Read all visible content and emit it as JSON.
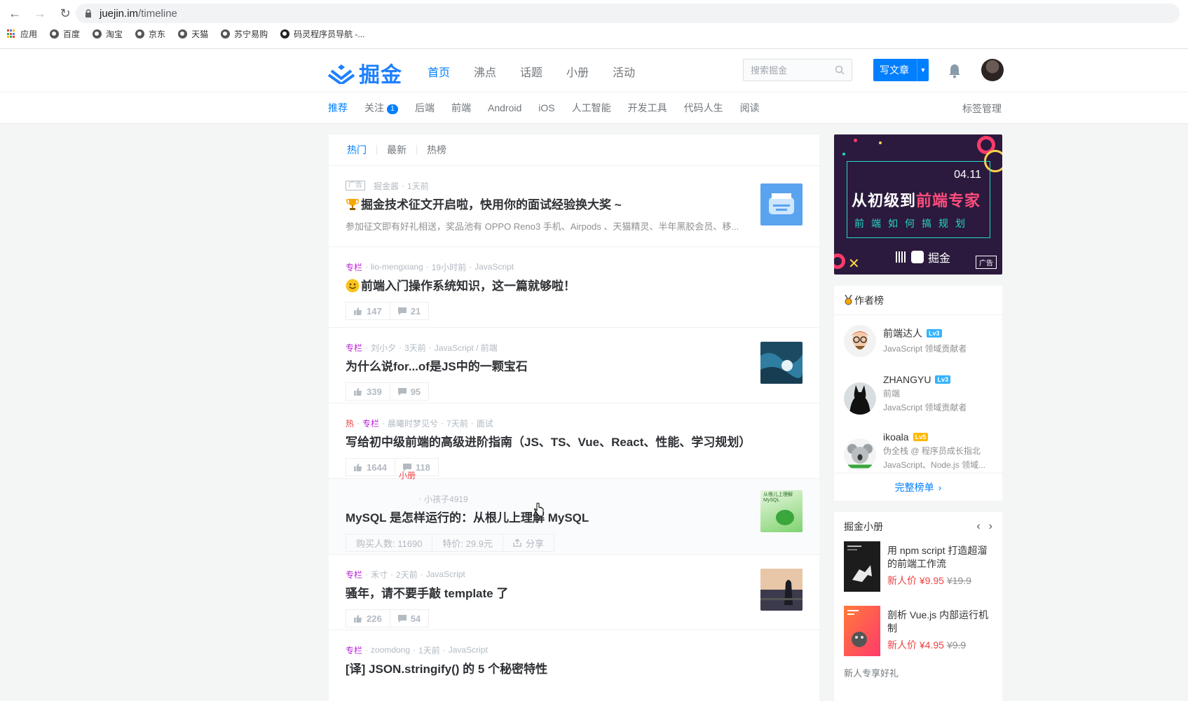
{
  "browser": {
    "url_host": "juejin.im",
    "url_path": "/timeline",
    "bookmarks": [
      {
        "label": "应用"
      },
      {
        "label": "百度"
      },
      {
        "label": "淘宝"
      },
      {
        "label": "京东"
      },
      {
        "label": "天猫"
      },
      {
        "label": "苏宁易购"
      },
      {
        "label": "码灵程序员导航 -..."
      }
    ]
  },
  "header": {
    "logo_text": "掘金",
    "nav": [
      "首页",
      "沸点",
      "话题",
      "小册",
      "活动"
    ],
    "search_placeholder": "搜索掘金",
    "write_label": "写文章"
  },
  "subnav": {
    "items": [
      "推荐",
      "关注",
      "后端",
      "前端",
      "Android",
      "iOS",
      "人工智能",
      "开发工具",
      "代码人生",
      "阅读"
    ],
    "follow_badge": "1",
    "tag_manage": "标签管理"
  },
  "feed": {
    "tabs": [
      "热门",
      "最新",
      "热榜"
    ],
    "entries": [
      {
        "ad": "广告",
        "meta": [
          "掘金酱",
          "1天前"
        ],
        "title": "掘金技术征文开启啦，快用你的面试经验换大奖 ~",
        "desc": "参加征文即有好礼相送，奖品池有 OPPO Reno3 手机、Airpods 、天猫精灵、半年黑胶会员、移..."
      },
      {
        "kind": "专栏",
        "meta": [
          "lio-mengxiang",
          "19小时前",
          "JavaScript"
        ],
        "title": "前端入门操作系统知识，这一篇就够啦！",
        "likes": "147",
        "comments": "21"
      },
      {
        "kind": "专栏",
        "meta": [
          "刘小夕",
          "3天前",
          "JavaScript / 前端"
        ],
        "title": "为什么说for...of是JS中的一颗宝石",
        "likes": "339",
        "comments": "95"
      },
      {
        "hot": "热",
        "kind": "专栏",
        "meta": [
          "晨曦时梦见兮",
          "7天前",
          "面试"
        ],
        "title": "写给初中级前端的高级进阶指南（JS、TS、Vue、React、性能、学习规划）",
        "likes": "1644",
        "comments": "118"
      },
      {
        "kind": "小册",
        "meta": [
          "小孩子4919"
        ],
        "title": "MySQL 是怎样运行的：从根儿上理解 MySQL",
        "buyers": "购买人数: 11690",
        "price": "特价: 29.9元",
        "share": "分享",
        "cover_title": "从根儿上理解MySQL"
      },
      {
        "kind": "专栏",
        "meta": [
          "禾寸",
          "2天前",
          "JavaScript"
        ],
        "title": "骚年，请不要手敲 template 了",
        "likes": "226",
        "comments": "54"
      },
      {
        "kind": "专栏",
        "meta": [
          "zoomdong",
          "1天前",
          "JavaScript"
        ],
        "title": "[译] JSON.stringify() 的 5 个秘密特性"
      }
    ]
  },
  "sidebar": {
    "banner": {
      "date": "04.11",
      "title_a": "从初级到",
      "title_b": "前端专家",
      "subtitle": "前端如何搞规划",
      "logo_text": "掘金",
      "ad": "广告"
    },
    "authors_title": "作者榜",
    "authors": [
      {
        "name": "前端达人",
        "level": "Lv3",
        "lines": [
          "JavaScript 领域贡献者"
        ],
        "lvcolor": "#35b3ff"
      },
      {
        "name": "ZHANGYU",
        "level": "Lv3",
        "lines": [
          "前端",
          "JavaScript 领域贡献者"
        ],
        "lvcolor": "#35b3ff"
      },
      {
        "name": "ikoala",
        "level": "Lv5",
        "lines": [
          "伪全栈 @ 程序员成长指北",
          "JavaScript、Node.js 领域..."
        ],
        "lvcolor": "#ffb800"
      }
    ],
    "authors_more": "完整榜单",
    "books_title": "掘金小册",
    "books": [
      {
        "title": "用 npm script 打造超溜的前端工作流",
        "price": "新人价 ¥9.95",
        "orig": "¥19.9"
      },
      {
        "title": "剖析 Vue.js 内部运行机制",
        "price": "新人价 ¥4.95",
        "orig": "¥9.9"
      }
    ],
    "books_footer": "新人专享好礼"
  }
}
